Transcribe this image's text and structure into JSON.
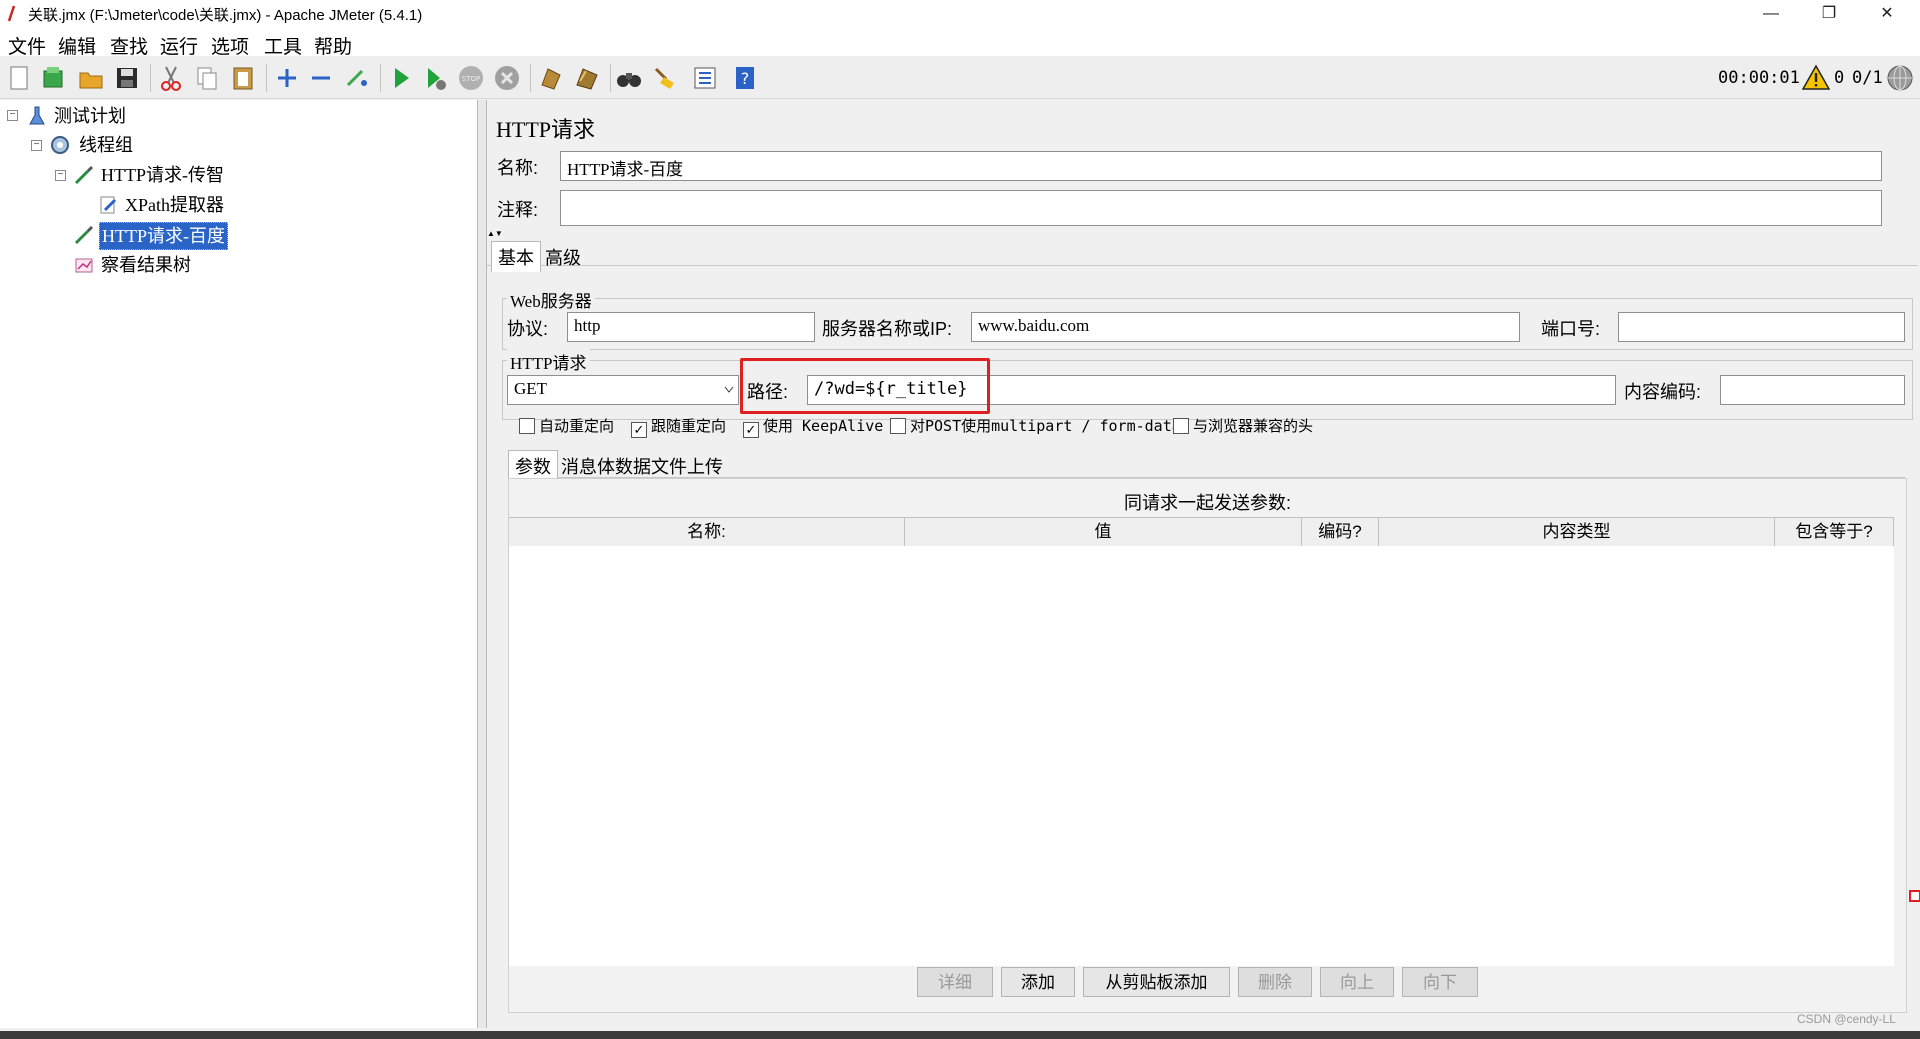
{
  "window": {
    "title": "关联.jmx (F:\\Jmeter\\code\\关联.jmx) - Apache JMeter (5.4.1)",
    "minimize": "—",
    "maximize": "❐",
    "close": "✕"
  },
  "menu": [
    "文件",
    "编辑",
    "查找",
    "运行",
    "选项",
    "工具",
    "帮助"
  ],
  "status": {
    "timer": "00:00:01",
    "warnings": "0",
    "threads": "0/1"
  },
  "tree": [
    {
      "label": "测试计划",
      "icon": "test-plan-icon"
    },
    {
      "label": "线程组",
      "icon": "thread-group-gear-icon"
    },
    {
      "label": "HTTP请求-传智",
      "icon": "sampler-pipette-icon"
    },
    {
      "label": "XPath提取器",
      "icon": "extractor-icon"
    },
    {
      "label": "HTTP请求-百度",
      "icon": "sampler-pipette-icon",
      "selected": true
    },
    {
      "label": "察看结果树",
      "icon": "results-tree-icon"
    }
  ],
  "panel": {
    "heading": "HTTP请求",
    "name_label": "名称:",
    "name_value": "HTTP请求-百度",
    "comment_label": "注释:",
    "comment_value": "",
    "tabs": [
      "基本",
      "高级"
    ],
    "web_server": {
      "title": "Web服务器",
      "protocol_label": "协议:",
      "protocol_value": "http",
      "server_label": "服务器名称或IP:",
      "server_value": "www.baidu.com",
      "port_label": "端口号:",
      "port_value": ""
    },
    "http_request": {
      "title": "HTTP请求",
      "method": "GET",
      "path_label": "路径:",
      "path_value": "/?wd=${r_title}",
      "encoding_label": "内容编码:",
      "encoding_value": ""
    },
    "checkboxes": [
      {
        "label": "自动重定向",
        "checked": false
      },
      {
        "label": "跟随重定向",
        "checked": true
      },
      {
        "label": "使用 KeepAlive",
        "checked": true
      },
      {
        "label": "对POST使用multipart / form-data",
        "checked": false
      },
      {
        "label": "与浏览器兼容的头",
        "checked": false
      }
    ],
    "subtabs": [
      "参数",
      "消息体数据",
      "文件上传"
    ],
    "params_caption": "同请求一起发送参数:",
    "columns": [
      "名称:",
      "值",
      "编码?",
      "内容类型",
      "包含等于?"
    ],
    "buttons": [
      {
        "label": "详细",
        "enabled": false
      },
      {
        "label": "添加",
        "enabled": true
      },
      {
        "label": "从剪贴板添加",
        "enabled": true
      },
      {
        "label": "删除",
        "enabled": false
      },
      {
        "label": "向上",
        "enabled": false
      },
      {
        "label": "向下",
        "enabled": false
      }
    ]
  },
  "watermark": "CSDN @cendy-LL",
  "colors": {
    "selection": "#2a64c6",
    "highlight_box": "#e02020"
  }
}
